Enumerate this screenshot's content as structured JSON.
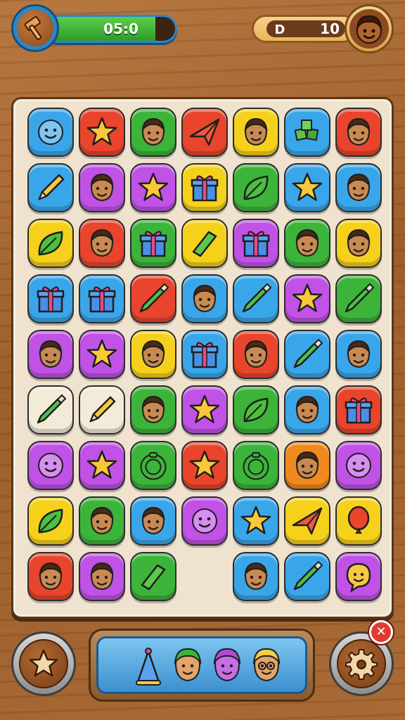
{
  "hud": {
    "timer_text": "05:0",
    "timer_fill": 0.85,
    "coin_icon_label": "D",
    "coins": "10"
  },
  "board": {
    "rows": [
      [
        "smiley-blue",
        "star-red",
        "face-green",
        "paperplane-red",
        "face-yellow",
        "cubes-blue",
        "face-red"
      ],
      [
        "pencil-blue",
        "face-purple",
        "star-purple",
        "gift-yellow",
        "leaf-green",
        "star-blue",
        "face-blue"
      ],
      [
        "leaf-yellow",
        "face-red",
        "gift-green",
        "bar-yellow",
        "gift-purple",
        "face-green",
        "face-yellow"
      ],
      [
        "gift-blue",
        "gift-blue",
        "crayon-red",
        "face-blue",
        "crayon-blue",
        "star-purple",
        "crayon-green"
      ],
      [
        "face-purple",
        "star-purple",
        "face-yellow",
        "gift-blue",
        "face-red",
        "crayon-blue",
        "face-blue"
      ],
      [
        "crayon-cream",
        "pencil-cream",
        "face-green",
        "star-purple",
        "leaf-green",
        "face-blue",
        "gift-red"
      ],
      [
        "smiley-purple",
        "star-purple",
        "ring-green",
        "star-red",
        "ring-green",
        "face-orange",
        "smiley-purple"
      ],
      [
        "leaf-yellow",
        "face-green",
        "face-blue",
        "smiley-purple",
        "star-blue",
        "paperplane-yellow",
        "balloon-yellow"
      ],
      [
        "face-red",
        "face-purple",
        "bar-green",
        "",
        "face-blue",
        "crayon-blue",
        "bubble-purple"
      ]
    ]
  },
  "tray": {
    "items": [
      "party-hat",
      "face-green-hair",
      "face-purple",
      "face-blonde-glasses"
    ]
  },
  "colors": {
    "blue": "#3aa6ea",
    "red": "#e8452c",
    "green": "#3cb43a",
    "yellow": "#f6d11c",
    "purple": "#c052e6",
    "orange": "#f08a1e",
    "cream": "#f3ead8"
  }
}
